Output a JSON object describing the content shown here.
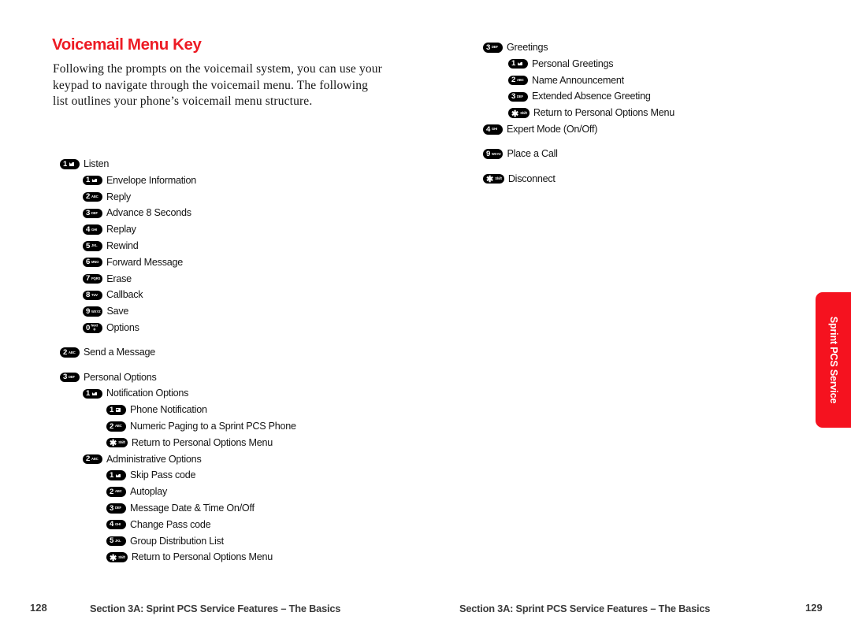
{
  "document": {
    "title": "Voicemail Menu Key",
    "title_color": "#ed1b24",
    "intro": "Following the prompts on the voicemail system, you can use your keypad to navigate through the voicemail menu. The following list outlines your phone’s voicemail menu structure."
  },
  "side_tab": {
    "label": "Sprint PCS Service",
    "color": "#f5121f"
  },
  "footer": {
    "left_page_number": "128",
    "left_section": "Section 3A: Sprint PCS Service Features – The Basics",
    "right_section": "Section 3A: Sprint PCS Service Features – The Basics",
    "right_page_number": "129"
  },
  "menu_left": [
    {
      "key": "1",
      "key_sub": "envelope",
      "level": 0,
      "label": "Listen",
      "gap": false
    },
    {
      "key": "1",
      "key_sub": "envelope",
      "level": 1,
      "label": "Envelope Information",
      "gap": false
    },
    {
      "key": "2",
      "key_sub": "ABC",
      "level": 1,
      "label": "Reply",
      "gap": false
    },
    {
      "key": "3",
      "key_sub": "DEF",
      "level": 1,
      "label": "Advance 8 Seconds",
      "gap": false
    },
    {
      "key": "4",
      "key_sub": "GHI",
      "level": 1,
      "label": "Replay",
      "gap": false
    },
    {
      "key": "5",
      "key_sub": "JKL",
      "level": 1,
      "label": "Rewind",
      "gap": false
    },
    {
      "key": "6",
      "key_sub": "MNO",
      "level": 1,
      "label": "Forward Message",
      "gap": false
    },
    {
      "key": "7",
      "key_sub": "PQRS",
      "level": 1,
      "label": "Erase",
      "gap": false
    },
    {
      "key": "8",
      "key_sub": "TUV",
      "level": 1,
      "label": "Callback",
      "gap": false
    },
    {
      "key": "9",
      "key_sub": "WXYZ",
      "level": 1,
      "label": "Save",
      "gap": false
    },
    {
      "key": "0",
      "key_sub": "Next+",
      "level": 1,
      "label": "Options",
      "gap": false
    },
    {
      "key": "2",
      "key_sub": "ABC",
      "level": 0,
      "label": "Send a Message",
      "gap": true
    },
    {
      "key": "3",
      "key_sub": "DEF",
      "level": 0,
      "label": "Personal Options",
      "gap": true
    },
    {
      "key": "1",
      "key_sub": "envelope",
      "level": 1,
      "label": "Notification Options",
      "gap": false
    },
    {
      "key": "1",
      "key_sub": "envelope",
      "level": 2,
      "label": "Phone Notification",
      "gap": false
    },
    {
      "key": "2",
      "key_sub": "ABC",
      "level": 2,
      "label": "Numeric Paging to a Sprint PCS Phone",
      "gap": false
    },
    {
      "key": "*",
      "key_sub": "Shift",
      "level": 2,
      "label": "Return to Personal Options Menu",
      "gap": false
    },
    {
      "key": "2",
      "key_sub": "ABC",
      "level": 1,
      "label": "Administrative Options",
      "gap": false
    },
    {
      "key": "1",
      "key_sub": "envelope",
      "level": 2,
      "label": "Skip Pass code",
      "gap": false
    },
    {
      "key": "2",
      "key_sub": "ABC",
      "level": 2,
      "label": "Autoplay",
      "gap": false
    },
    {
      "key": "3",
      "key_sub": "DEF",
      "level": 2,
      "label": "Message Date & Time On/Off",
      "gap": false
    },
    {
      "key": "4",
      "key_sub": "GHI",
      "level": 2,
      "label": "Change Pass code",
      "gap": false
    },
    {
      "key": "5",
      "key_sub": "JKL",
      "level": 2,
      "label": "Group Distribution List",
      "gap": false
    },
    {
      "key": "*",
      "key_sub": "Shift",
      "level": 2,
      "label": "Return to Personal Options Menu",
      "gap": false
    }
  ],
  "menu_right": [
    {
      "key": "3",
      "key_sub": "DEF",
      "level": 0,
      "label": "Greetings",
      "gap": false
    },
    {
      "key": "1",
      "key_sub": "envelope",
      "level": 1,
      "label": "Personal Greetings",
      "gap": false
    },
    {
      "key": "2",
      "key_sub": "ABC",
      "level": 1,
      "label": "Name Announcement",
      "gap": false
    },
    {
      "key": "3",
      "key_sub": "DEF",
      "level": 1,
      "label": "Extended Absence Greeting",
      "gap": false
    },
    {
      "key": "*",
      "key_sub": "Shift",
      "level": 1,
      "label": "Return to Personal Options Menu",
      "gap": false
    },
    {
      "key": "4",
      "key_sub": "GHI",
      "level": 0,
      "label": "Expert Mode (On/Off)",
      "gap": false
    },
    {
      "key": "9",
      "key_sub": "WXYZ",
      "level": 0,
      "label": "Place a Call",
      "gap": true
    },
    {
      "key": "*",
      "key_sub": "Shift",
      "level": 0,
      "label": "Disconnect",
      "gap": true
    }
  ]
}
